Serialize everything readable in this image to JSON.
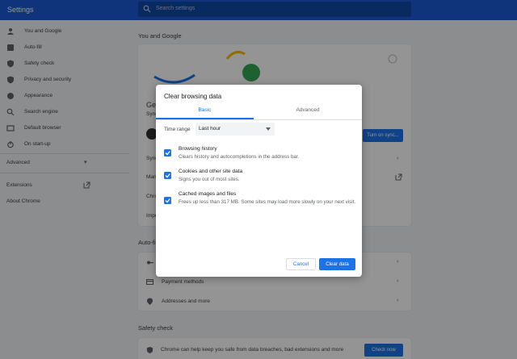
{
  "header": {
    "title": "Settings",
    "search_placeholder": "Search settings"
  },
  "sidebar": {
    "items": [
      {
        "label": "You and Google",
        "icon": "person-icon"
      },
      {
        "label": "Auto-fill",
        "icon": "autofill-icon"
      },
      {
        "label": "Safety check",
        "icon": "shield-icon"
      },
      {
        "label": "Privacy and security",
        "icon": "privacy-shield-icon"
      },
      {
        "label": "Appearance",
        "icon": "palette-icon"
      },
      {
        "label": "Search engine",
        "icon": "search-icon"
      },
      {
        "label": "Default browser",
        "icon": "browser-icon"
      },
      {
        "label": "On start-up",
        "icon": "power-icon"
      }
    ],
    "advanced": "Advanced",
    "extensions": "Extensions",
    "about": "About Chrome"
  },
  "main": {
    "you_and_google": "You and Google",
    "get_started_partial": "Get",
    "sync_partial": "Sync",
    "turn_on_sync": "Turn on sync...",
    "rows_partial": [
      "Sync",
      "Mana",
      "Chro",
      "Impo"
    ],
    "autofill_header": "Auto-fi",
    "payment_methods": "Payment methods",
    "addresses": "Addresses and more",
    "safety_check_header": "Safety check",
    "safety_text": "Chrome can help keep you safe from data breaches, bad extensions and more",
    "check_now": "Check now"
  },
  "dialog": {
    "title": "Clear browsing data",
    "tabs": {
      "basic": "Basic",
      "advanced": "Advanced"
    },
    "time_range_label": "Time range",
    "time_range_value": "Last hour",
    "options": [
      {
        "title": "Browsing history",
        "desc": "Clears history and autocompletions in the address bar.",
        "checked": true
      },
      {
        "title": "Cookies and other site data",
        "desc": "Signs you out of most sites.",
        "checked": true
      },
      {
        "title": "Cached images and files",
        "desc": "Frees up less than 317 MB. Some sites may load more slowly on your next visit.",
        "checked": true
      }
    ],
    "cancel": "Cancel",
    "clear": "Clear data"
  },
  "colors": {
    "header_blue": "#1a5bd6",
    "accent": "#1a73e8"
  }
}
